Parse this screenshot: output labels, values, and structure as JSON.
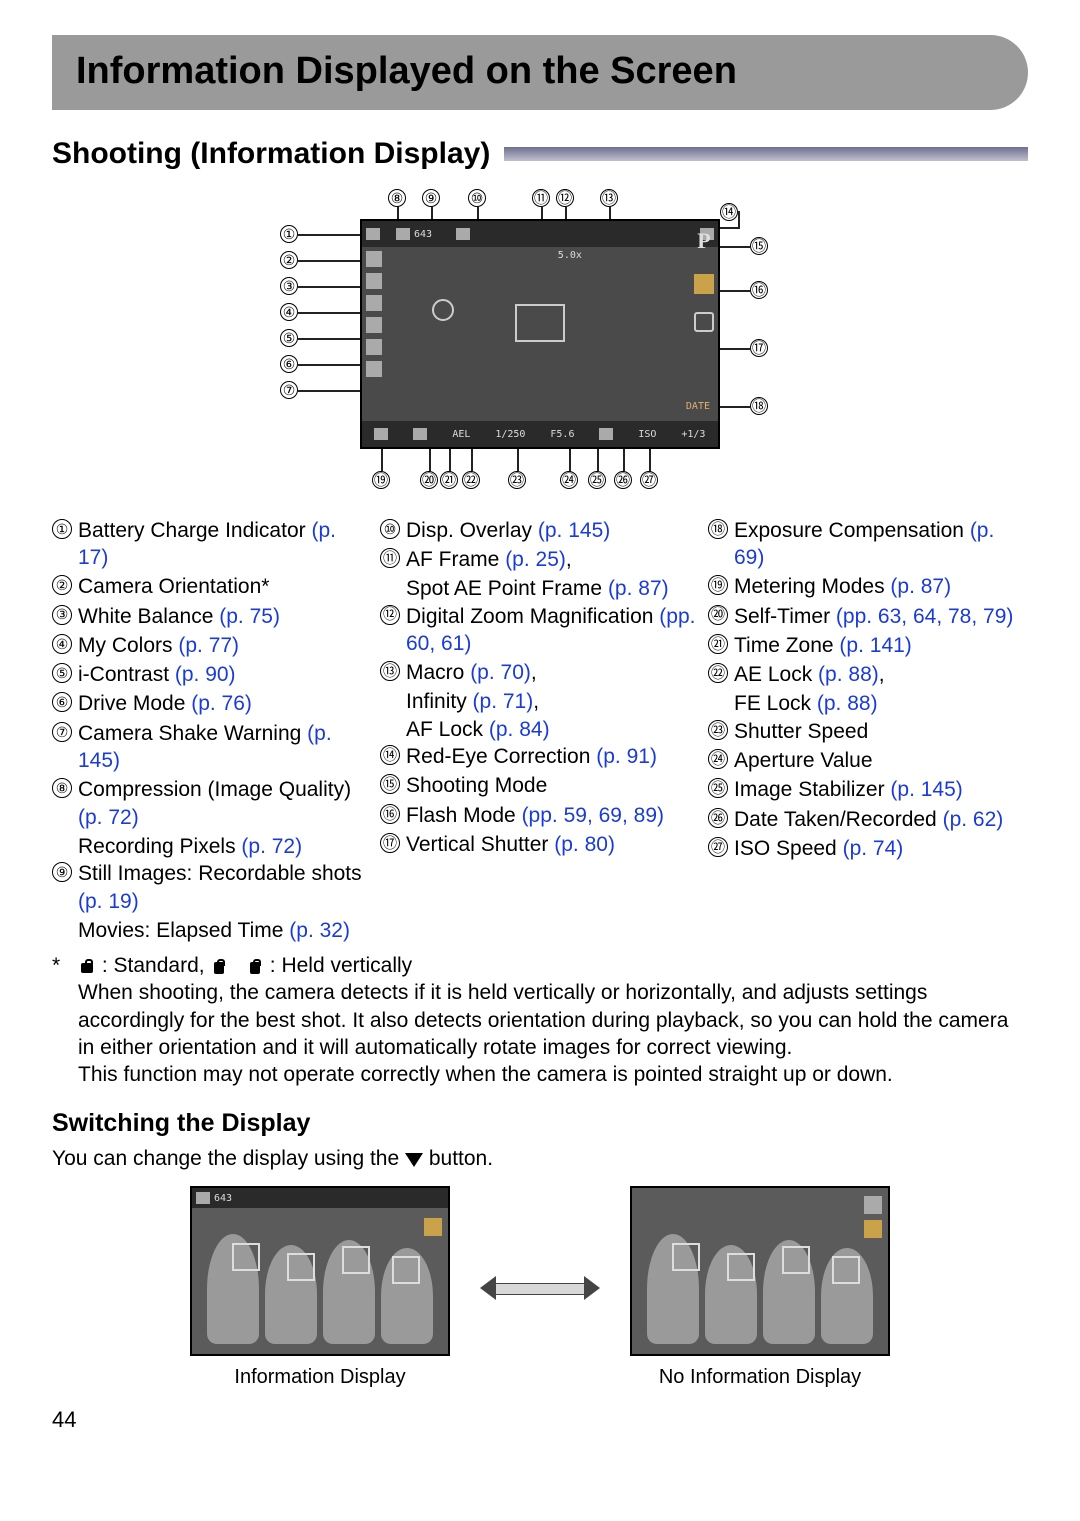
{
  "title": "Information Displayed on the Screen",
  "section": "Shooting (Information Display)",
  "screen": {
    "top_l": "643",
    "zoom": "5.0x",
    "date": "DATE",
    "bot": {
      "ael": "AEL",
      "shutter": "1/250",
      "ap": "F5.6",
      "iso": "ISO",
      "ev": "+1/3"
    },
    "mode_p": "P"
  },
  "callouts_top": [
    "⑧",
    "⑨",
    "⑩",
    "⑪",
    "⑫",
    "⑬",
    "⑭"
  ],
  "callouts_left": [
    "①",
    "②",
    "③",
    "④",
    "⑤",
    "⑥",
    "⑦"
  ],
  "callouts_right": [
    "⑮",
    "⑯",
    "⑰",
    "⑱"
  ],
  "callouts_bot": [
    "⑲",
    "⑳",
    "㉑",
    "㉒",
    "㉓",
    "㉔",
    "㉕",
    "㉖",
    "㉗"
  ],
  "legend": {
    "col1": [
      {
        "n": "①",
        "text": "Battery Charge Indicator ",
        "pref": "(p. 17)"
      },
      {
        "n": "②",
        "text": "Camera Orientation*",
        "pref": ""
      },
      {
        "n": "③",
        "text": "White Balance ",
        "pref": "(p. 75)"
      },
      {
        "n": "④",
        "text": "My Colors ",
        "pref": "(p. 77)"
      },
      {
        "n": "⑤",
        "text": "i-Contrast ",
        "pref": "(p. 90)"
      },
      {
        "n": "⑥",
        "text": "Drive Mode ",
        "pref": "(p. 76)"
      },
      {
        "n": "⑦",
        "text": "Camera Shake Warning ",
        "pref": "(p. 145)"
      },
      {
        "n": "⑧",
        "text": "Compression (Image Quality) ",
        "pref": "(p. 72)",
        "sub": "Recording Pixels ",
        "subpref": "(p. 72)"
      },
      {
        "n": "⑨",
        "text": "Still Images: Recordable shots ",
        "pref": "(p. 19)",
        "sub": "Movies: Elapsed Time ",
        "subpref": "(p. 32)"
      }
    ],
    "col2": [
      {
        "n": "⑩",
        "text": "Disp. Overlay ",
        "pref": "(p. 145)"
      },
      {
        "n": "⑪",
        "text": "AF Frame ",
        "pref": "(p. 25)",
        "cont": ", ",
        "sub": "Spot AE Point Frame ",
        "subpref": "(p. 87)"
      },
      {
        "n": "⑫",
        "text": "Digital Zoom Magnification ",
        "pref": "(pp. 60, 61)"
      },
      {
        "n": "⑬",
        "text": "Macro ",
        "pref": "(p. 70)",
        "cont": ", ",
        "sub": "Infinity ",
        "subpref": "(p. 71)",
        "cont2": ", ",
        "sub2": "AF Lock ",
        "subpref2": "(p. 84)"
      },
      {
        "n": "⑭",
        "text": "Red-Eye Correction ",
        "pref": "(p. 91)"
      },
      {
        "n": "⑮",
        "text": "Shooting Mode",
        "pref": ""
      },
      {
        "n": "⑯",
        "text": "Flash Mode ",
        "pref": "(pp. 59, 69, 89)"
      },
      {
        "n": "⑰",
        "text": "Vertical Shutter ",
        "pref": "(p. 80)"
      }
    ],
    "col3": [
      {
        "n": "⑱",
        "text": "Exposure Compensation ",
        "pref": "(p. 69)"
      },
      {
        "n": "⑲",
        "text": "Metering Modes ",
        "pref": "(p. 87)"
      },
      {
        "n": "⑳",
        "text": "Self-Timer ",
        "pref": "(pp. 63, 64, 78, 79)"
      },
      {
        "n": "㉑",
        "text": "Time Zone ",
        "pref": "(p. 141)"
      },
      {
        "n": "㉒",
        "text": "AE Lock ",
        "pref": "(p. 88)",
        "cont": ", ",
        "sub": "FE Lock ",
        "subpref": "(p. 88)"
      },
      {
        "n": "㉓",
        "text": "Shutter Speed",
        "pref": ""
      },
      {
        "n": "㉔",
        "text": "Aperture Value",
        "pref": ""
      },
      {
        "n": "㉕",
        "text": "Image Stabilizer ",
        "pref": "(p. 145)"
      },
      {
        "n": "㉖",
        "text": "Date Taken/Recorded ",
        "pref": "(p. 62)"
      },
      {
        "n": "㉗",
        "text": "ISO Speed ",
        "pref": "(p. 74)"
      }
    ]
  },
  "note": {
    "star": "*",
    "std_label": " : Standard,   ",
    "held_label": " : Held vertically",
    "body1": "When shooting, the camera detects if it is held vertically or horizontally, and adjusts settings accordingly for the best shot. It also detects orientation during playback, so you can hold the camera in either orientation and it will automatically rotate images for correct viewing.",
    "body2": "This function may not operate correctly when the camera is pointed straight up or down."
  },
  "switching": {
    "title": "Switching the Display",
    "sentence_a": "You can change the display using the ",
    "sentence_b": " button.",
    "cap1": "Information Display",
    "cap2": "No Information Display"
  },
  "page": "44"
}
